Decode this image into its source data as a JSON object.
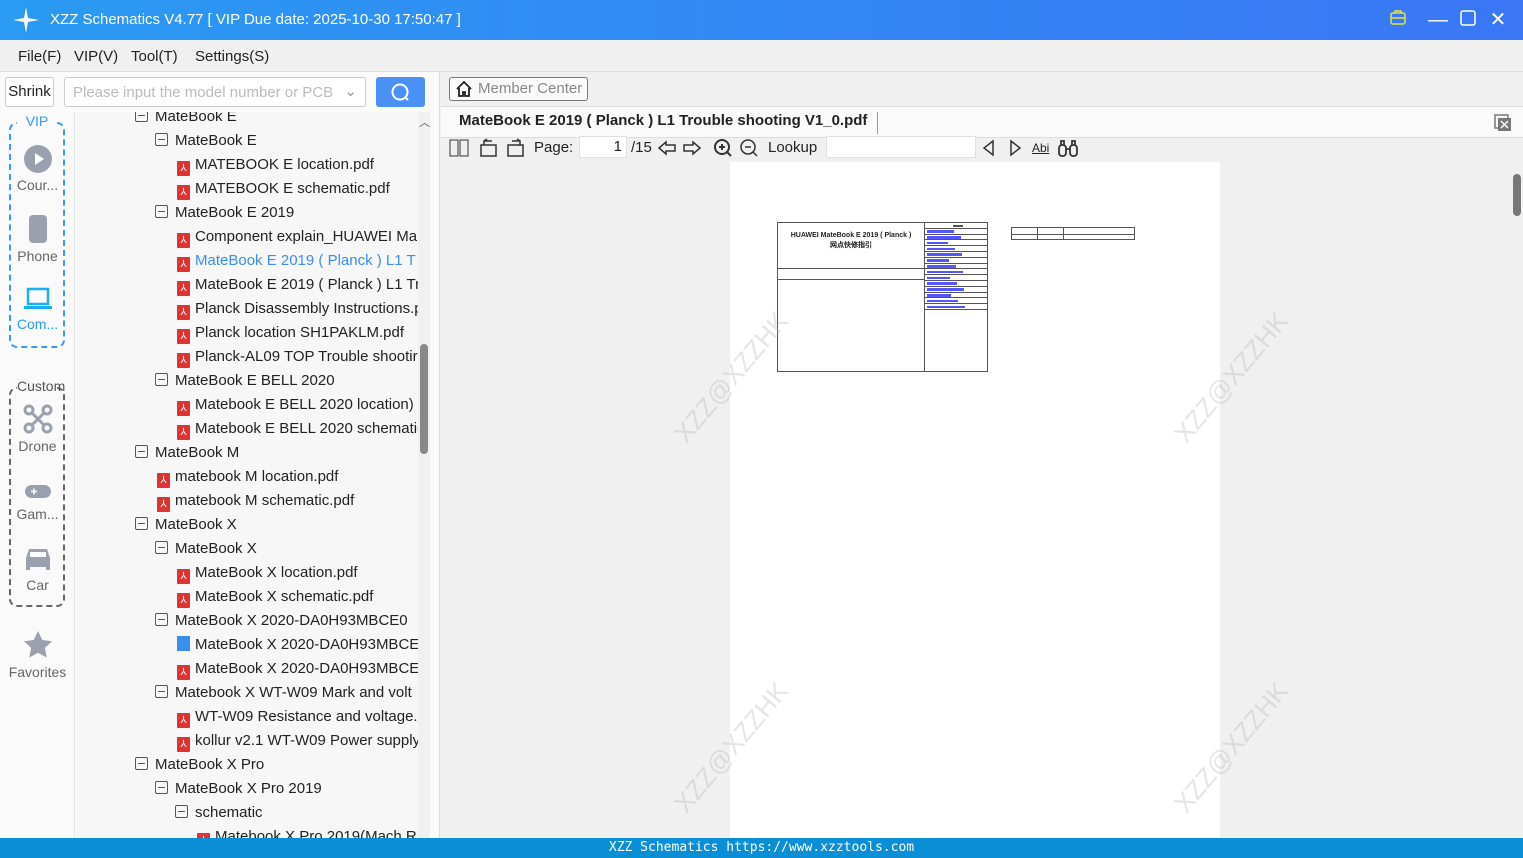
{
  "window": {
    "title": "XZZ Schematics V4.77 [ VIP Due date: 2025-10-30 17:50:47 ]"
  },
  "menu": [
    "File(F)",
    "VIP(V)",
    "Tool(T)",
    "Settings(S)"
  ],
  "search": {
    "shrink_label": "Shrink",
    "placeholder": "Please input the model number or PCB"
  },
  "nav": {
    "vip_label": "VIP",
    "custom_label": "Custom",
    "items": [
      "Cour...",
      "Phone",
      "Com...",
      "Drone",
      "Gam...",
      "Car",
      "Favorites"
    ]
  },
  "tree": [
    {
      "text": "MateBook E",
      "type": "folder",
      "level": 0
    },
    {
      "text": "MateBook E",
      "type": "folder",
      "level": 1
    },
    {
      "text": "MATEBOOK E location.pdf",
      "type": "pdf",
      "level": 2
    },
    {
      "text": "MATEBOOK E schematic.pdf",
      "type": "pdf",
      "level": 2
    },
    {
      "text": "MateBook E 2019",
      "type": "folder",
      "level": 1
    },
    {
      "text": "Component explain_HUAWEI Ma",
      "type": "pdf",
      "level": 2
    },
    {
      "text": "MateBook E 2019 ( Planck )  L1 T",
      "type": "pdf",
      "level": 2,
      "selected": true
    },
    {
      "text": "MateBook E 2019 ( Planck ) L1 Tr",
      "type": "pdf",
      "level": 2
    },
    {
      "text": "Planck Disassembly Instructions.p",
      "type": "pdf",
      "level": 2
    },
    {
      "text": "Planck location SH1PAKLM.pdf",
      "type": "pdf",
      "level": 2
    },
    {
      "text": "Planck-AL09 TOP Trouble shootir",
      "type": "pdf",
      "level": 2
    },
    {
      "text": "MateBook E BELL 2020",
      "type": "folder",
      "level": 1
    },
    {
      "text": "Matebook E  BELL 2020  location)",
      "type": "pdf",
      "level": 2
    },
    {
      "text": "Matebook E BELL 2020 schematic",
      "type": "pdf",
      "level": 2
    },
    {
      "text": "MateBook M",
      "type": "folder",
      "level": 0
    },
    {
      "text": "matebook M location.pdf",
      "type": "pdf",
      "level": 1
    },
    {
      "text": "matebook M schematic.pdf",
      "type": "pdf",
      "level": 1
    },
    {
      "text": "MateBook X",
      "type": "folder",
      "level": 0
    },
    {
      "text": "MateBook X",
      "type": "folder",
      "level": 1
    },
    {
      "text": "MateBook X location.pdf",
      "type": "pdf",
      "level": 2
    },
    {
      "text": "MateBook X schematic.pdf",
      "type": "pdf",
      "level": 2
    },
    {
      "text": "MateBook X 2020-DA0H93MBCE0",
      "type": "folder",
      "level": 1
    },
    {
      "text": "MateBook X 2020-DA0H93MBCE(",
      "type": "schematic",
      "level": 2
    },
    {
      "text": "MateBook X 2020-DA0H93MBCE(",
      "type": "pdf",
      "level": 2
    },
    {
      "text": "Matebook X WT-W09 Mark and volt",
      "type": "folder",
      "level": 1
    },
    {
      "text": "WT-W09 Resistance and voltage.p",
      "type": "pdf",
      "level": 2
    },
    {
      "text": "kollur v2.1 WT-W09 Power supply",
      "type": "pdf",
      "level": 2
    },
    {
      "text": "MateBook X Pro",
      "type": "folder",
      "level": 0
    },
    {
      "text": "MateBook X Pro 2019",
      "type": "folder",
      "level": 1
    },
    {
      "text": "schematic",
      "type": "folder",
      "level": 2
    },
    {
      "text": "Matebook X Pro 2019(Mach R",
      "type": "pdf",
      "level": 3
    }
  ],
  "viewer": {
    "member_center": "Member Center",
    "tab_title": "MateBook E 2019 ( Planck )  L1 Trouble shooting V1_0.pdf",
    "page_label": "Page:",
    "page_current": "1",
    "page_total": "/15",
    "lookup_label": "Lookup",
    "abi_label": "Abi",
    "doc_title": "HUAWEI MateBook E 2019 ( Planck )",
    "doc_subtitle": "网点快修指引",
    "watermark": "XZZ@XZZHK"
  },
  "status": "XZZ Schematics https://www.xzztools.com",
  "colors": {
    "accent": "#3b8df0",
    "titlebar": "#2a9af2",
    "status": "#0a8fd6"
  }
}
